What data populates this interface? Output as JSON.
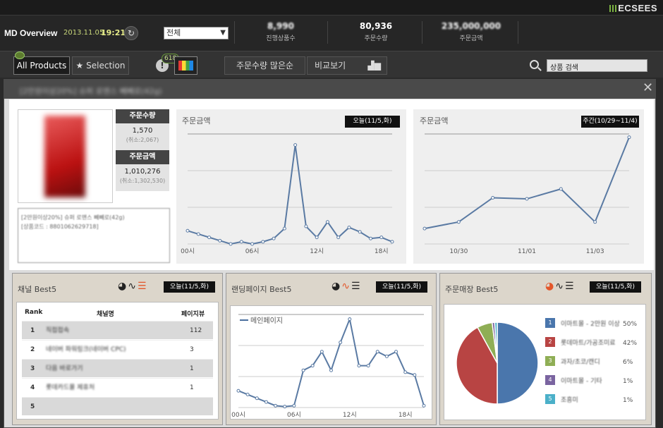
{
  "brand": {
    "logo": "ECSEES"
  },
  "header": {
    "title": "MD Overview",
    "date": "2013.11.05",
    "time": "19:21",
    "store_select": "전체",
    "stats": [
      {
        "value": "8,990",
        "label": "진행상품수"
      },
      {
        "value": "80,936",
        "label": "주문수량"
      },
      {
        "value": "235,000,000",
        "label": "주문금액"
      }
    ]
  },
  "toolbar": {
    "all_products": "All Products",
    "selection": "Selection",
    "alert_count": "618",
    "sort_label": "주문수량 많은순",
    "compare_label": "비교보기",
    "search_value": "상품 검색"
  },
  "product": {
    "title": "[2만원이상20%] 슈퍼 로맨스 빼빼로(42g)",
    "metrics": [
      {
        "label": "주문수량",
        "value": "1,570",
        "sub": "(취소:2,067)"
      },
      {
        "label": "주문금액",
        "value": "1,010,276",
        "sub": "(취소:1,302,530)"
      }
    ],
    "info": [
      "[2만원이상20%] 슈퍼 로맨스 빼빼로(42g)",
      "[상품코드 : 8801062629718]"
    ]
  },
  "chart_data": [
    {
      "type": "line",
      "title": "주문금액",
      "badge": "오늘(11/5,화)",
      "x": [
        "00시",
        "01시",
        "02시",
        "03시",
        "04시",
        "05시",
        "06시",
        "07시",
        "08시",
        "09시",
        "10시",
        "11시",
        "12시",
        "13시",
        "14시",
        "15시",
        "16시",
        "17시",
        "18시",
        "19시"
      ],
      "tick_labels": [
        "00시",
        "06시",
        "12시",
        "18시"
      ],
      "series": [
        {
          "values": [
            12,
            9,
            6,
            3,
            0,
            2,
            0,
            2,
            5,
            14,
            90,
            16,
            6,
            20,
            6,
            15,
            11,
            5,
            6,
            2
          ]
        }
      ],
      "ylim": [
        0,
        100
      ]
    },
    {
      "type": "line",
      "title": "주문금액",
      "badge": "주간(10/29~11/4)",
      "x": [
        "10/29",
        "10/30",
        "10/31",
        "11/01",
        "11/02",
        "11/03",
        "11/04"
      ],
      "tick_labels": [
        "",
        "10/30",
        "",
        "11/01",
        "",
        "11/03",
        ""
      ],
      "series": [
        {
          "values": [
            14,
            20,
            42,
            41,
            50,
            20,
            97
          ]
        }
      ],
      "ylim": [
        0,
        100
      ]
    },
    {
      "type": "table",
      "title": "채널 Best5",
      "badge": "오늘(11/5,화)",
      "columns": [
        "Rank",
        "채널명",
        "페이지뷰"
      ],
      "rows": [
        [
          "1",
          "직접접속",
          "112"
        ],
        [
          "2",
          "네이버 파워링크(네이버 CPC)",
          "3"
        ],
        [
          "3",
          "다음 바로가기",
          "1"
        ],
        [
          "4",
          "롯데카드몰 제휴처",
          "1"
        ],
        [
          "5",
          "",
          ""
        ]
      ]
    },
    {
      "type": "line",
      "title": "랜딩페이지 Best5",
      "badge": "오늘(11/5,화)",
      "x": [
        "00시",
        "01시",
        "02시",
        "03시",
        "04시",
        "05시",
        "06시",
        "07시",
        "08시",
        "09시",
        "10시",
        "11시",
        "12시",
        "13시",
        "14시",
        "15시",
        "16시",
        "17시",
        "18시",
        "19시"
      ],
      "tick_labels": [
        "00시",
        "06시",
        "12시",
        "18시"
      ],
      "series": [
        {
          "name": "메인페이지",
          "values": [
            18,
            14,
            10,
            6,
            2,
            1,
            2,
            40,
            45,
            60,
            40,
            70,
            95,
            45,
            45,
            60,
            55,
            60,
            38,
            35,
            2
          ]
        }
      ],
      "ylim": [
        0,
        100
      ]
    },
    {
      "type": "pie",
      "title": "주문매장 Best5",
      "badge": "오늘(11/5,화)",
      "series": [
        {
          "values": [
            50,
            42,
            6,
            1,
            1
          ]
        }
      ],
      "categories": [
        "이마트몰 - 2만원 이상",
        "롯데마트/가공조미료",
        "과자/초코/캔디",
        "이마트몰 - 기타",
        "조흥미"
      ],
      "labels": [
        "50%",
        "42%",
        "6%",
        "1%",
        "1%"
      ],
      "colors": [
        "#4a76ac",
        "#b84443",
        "#8fae55",
        "#7a64a0",
        "#4bb0c9"
      ]
    }
  ]
}
